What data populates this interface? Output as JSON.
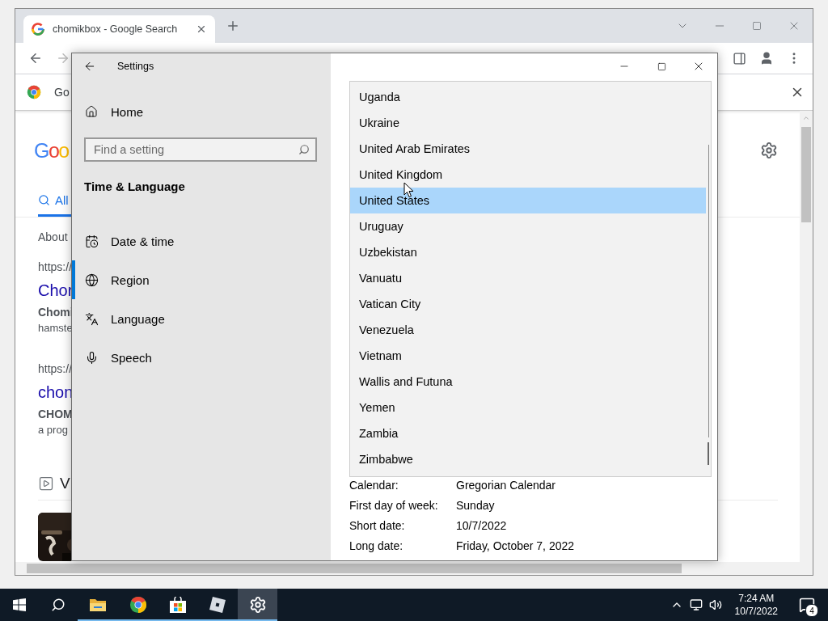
{
  "browser": {
    "tab": {
      "title": "chomikbox - Google Search"
    },
    "infobar": {
      "text": "Go"
    },
    "content": {
      "logo": "Goo",
      "tabs": [
        {
          "label": "All",
          "selected": true
        }
      ],
      "about": "About",
      "results": [
        {
          "url": "https://",
          "title": "Chor",
          "bold": "Chomi",
          "snippet": "hamste"
        },
        {
          "url": "https://",
          "title": "chon",
          "bold": "CHOM",
          "snippet": "a prog"
        }
      ],
      "videos_heading": "V"
    }
  },
  "settings": {
    "title": "Settings",
    "home": "Home",
    "search": {
      "placeholder": "Find a setting"
    },
    "section": "Time & Language",
    "nav": [
      {
        "label": "Date & time",
        "kind": "calendar",
        "selected": false
      },
      {
        "label": "Region",
        "kind": "globe",
        "selected": true
      },
      {
        "label": "Language",
        "kind": "language",
        "selected": false
      },
      {
        "label": "Speech",
        "kind": "microphone",
        "selected": false
      }
    ],
    "country_list": [
      {
        "label": "Uganda",
        "selected": false
      },
      {
        "label": "Ukraine",
        "selected": false
      },
      {
        "label": "United Arab Emirates",
        "selected": false
      },
      {
        "label": "United Kingdom",
        "selected": false
      },
      {
        "label": "United States",
        "selected": true
      },
      {
        "label": "Uruguay",
        "selected": false
      },
      {
        "label": "Uzbekistan",
        "selected": false
      },
      {
        "label": "Vanuatu",
        "selected": false
      },
      {
        "label": "Vatican City",
        "selected": false
      },
      {
        "label": "Venezuela",
        "selected": false
      },
      {
        "label": "Vietnam",
        "selected": false
      },
      {
        "label": "Wallis and Futuna",
        "selected": false
      },
      {
        "label": "Yemen",
        "selected": false
      },
      {
        "label": "Zambia",
        "selected": false
      },
      {
        "label": "Zimbabwe",
        "selected": false
      }
    ],
    "formats": [
      {
        "label": "Calendar:",
        "value": "Gregorian Calendar"
      },
      {
        "label": "First day of week:",
        "value": "Sunday"
      },
      {
        "label": "Short date:",
        "value": "10/7/2022"
      },
      {
        "label": "Long date:",
        "value": "Friday, October 7, 2022"
      }
    ]
  },
  "taskbar": {
    "apps": [
      {
        "kind": "start",
        "running": false,
        "selected": false
      },
      {
        "kind": "search",
        "running": false,
        "selected": false
      },
      {
        "kind": "explorer",
        "running": true,
        "selected": false
      },
      {
        "kind": "chrome",
        "running": true,
        "selected": false
      },
      {
        "kind": "store",
        "running": true,
        "selected": false
      },
      {
        "kind": "roblox",
        "running": true,
        "selected": false
      },
      {
        "kind": "settings",
        "running": true,
        "selected": true
      }
    ],
    "time": "7:24 AM",
    "date": "10/7/2022",
    "notifications": "4"
  }
}
